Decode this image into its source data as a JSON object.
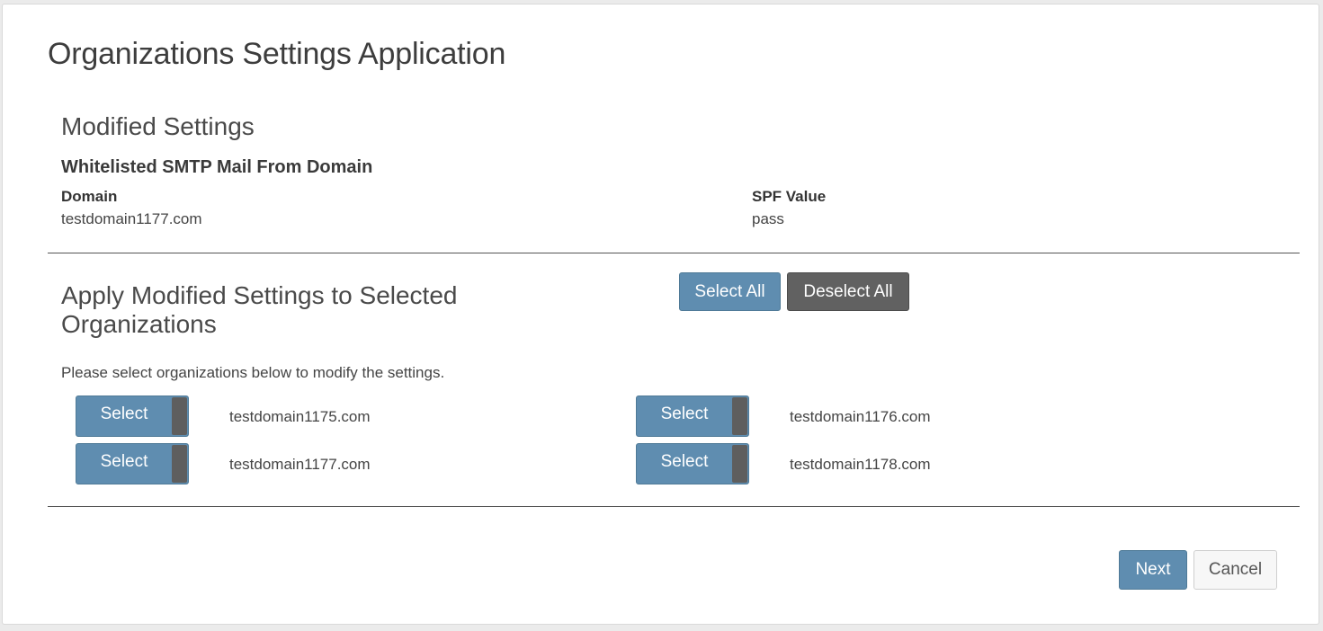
{
  "header": {
    "title": "Organizations Settings Application"
  },
  "modified_settings": {
    "title": "Modified Settings",
    "setting_name": "Whitelisted SMTP Mail From Domain",
    "domain_label": "Domain",
    "domain_value": "testdomain1177.com",
    "spf_label": "SPF Value",
    "spf_value": "pass"
  },
  "apply_section": {
    "title_line1": "Apply Modified Settings to Selected",
    "title_line2": "Organizations",
    "select_all_label": "Select All",
    "deselect_all_label": "Deselect All",
    "instruction": "Please select organizations below to modify the settings.",
    "organizations": [
      {
        "toggle_label": "Select",
        "name": "testdomain1175.com"
      },
      {
        "toggle_label": "Select",
        "name": "testdomain1176.com"
      },
      {
        "toggle_label": "Select",
        "name": "testdomain1177.com"
      },
      {
        "toggle_label": "Select",
        "name": "testdomain1178.com"
      }
    ]
  },
  "footer": {
    "next_label": "Next",
    "cancel_label": "Cancel"
  },
  "colors": {
    "primary_button": "#5f8db0",
    "dark_button": "#616161",
    "light_button": "#f7f7f7"
  }
}
